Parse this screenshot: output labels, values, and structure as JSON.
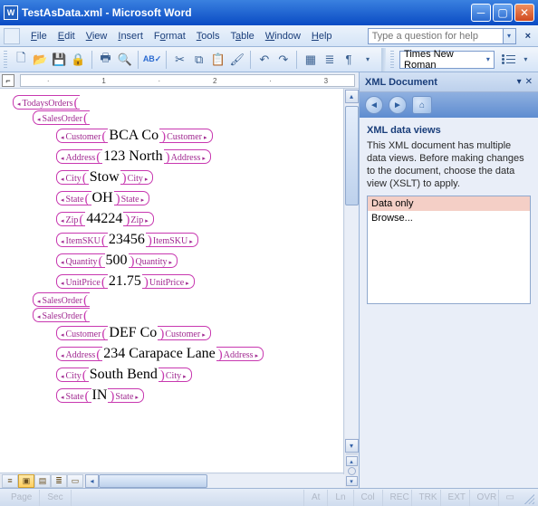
{
  "window": {
    "title": "TestAsData.xml - Microsoft Word"
  },
  "menu": {
    "items": [
      "File",
      "Edit",
      "View",
      "Insert",
      "Format",
      "Tools",
      "Table",
      "Window",
      "Help"
    ],
    "ask_placeholder": "Type a question for help"
  },
  "toolbar": {
    "font": "Times New Roman"
  },
  "ruler": {
    "marks": [
      "",
      "1",
      "",
      "2",
      "",
      "3"
    ]
  },
  "doc": {
    "root": "TodaysOrders",
    "orders": [
      {
        "tag": "SalesOrder",
        "fields": [
          {
            "tag": "Customer",
            "val": "BCA Co"
          },
          {
            "tag": "Address",
            "val": "123 North"
          },
          {
            "tag": "City",
            "val": "Stow"
          },
          {
            "tag": "State",
            "val": "OH"
          },
          {
            "tag": "Zip",
            "val": "44224"
          },
          {
            "tag": "ItemSKU",
            "val": "23456"
          },
          {
            "tag": "Quantity",
            "val": "500"
          },
          {
            "tag": "UnitPrice",
            "val": "21.75"
          }
        ]
      },
      {
        "tag": "SalesOrder",
        "fields": []
      },
      {
        "tag": "SalesOrder",
        "fields": [
          {
            "tag": "Customer",
            "val": "DEF Co"
          },
          {
            "tag": "Address",
            "val": "234 Carapace Lane"
          },
          {
            "tag": "City",
            "val": "South Bend"
          },
          {
            "tag": "State",
            "val": "IN"
          }
        ]
      }
    ]
  },
  "pane": {
    "title": "XML Document",
    "subtitle": "XML data views",
    "desc": "This XML document has multiple data views. Before making changes to the document, choose the data view (XSLT) to apply.",
    "items": [
      "Data only",
      "Browse..."
    ],
    "selected": 0
  },
  "status": {
    "cells": [
      "Page",
      "Sec",
      "",
      "At",
      "Ln",
      "Col"
    ],
    "inds": [
      "REC",
      "TRK",
      "EXT",
      "OVR"
    ]
  }
}
